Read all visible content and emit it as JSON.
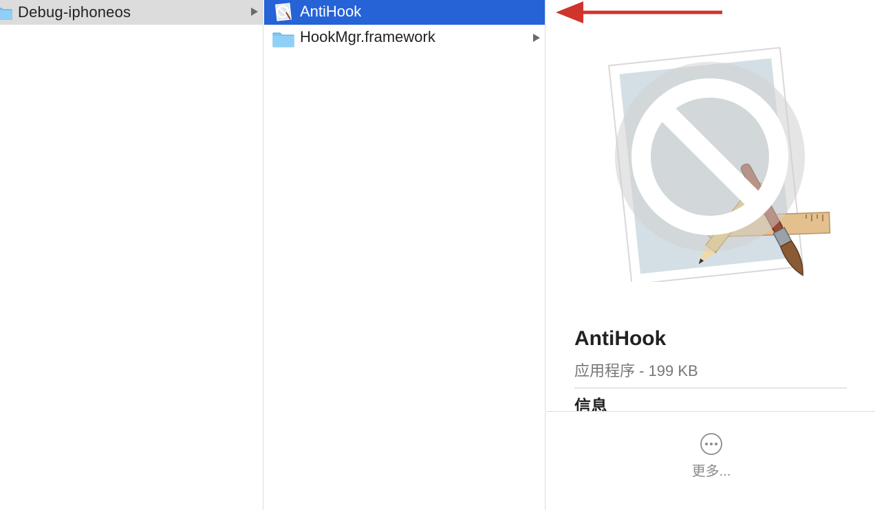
{
  "column1": {
    "selected_item": {
      "label": "Debug-iphoneos",
      "icon": "folder-icon"
    }
  },
  "column2": {
    "items": [
      {
        "label": "AntiHook",
        "icon": "app-icon",
        "selected": true
      },
      {
        "label": "HookMgr.framework",
        "icon": "folder-icon",
        "selected": false
      }
    ]
  },
  "preview": {
    "name": "AntiHook",
    "kind": "应用程序 - 199 KB",
    "section_title": "信息",
    "more_label": "更多..."
  },
  "colors": {
    "selection_blue": "#2563d6",
    "inactive_selection": "#dcdcdc",
    "annotation_red": "#d0342c"
  }
}
